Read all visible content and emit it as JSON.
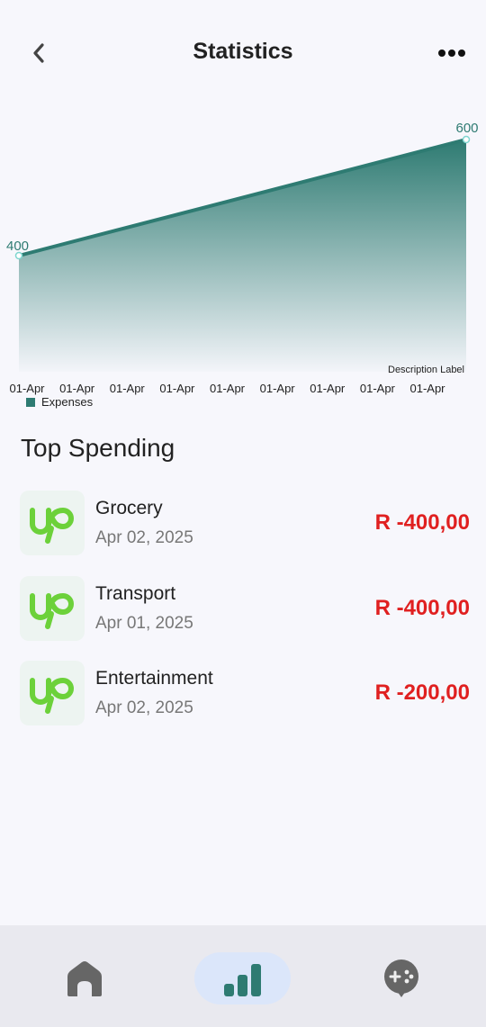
{
  "header": {
    "title": "Statistics"
  },
  "chart_data": {
    "type": "area",
    "x": [
      "01-Apr",
      "01-Apr",
      "01-Apr",
      "01-Apr",
      "01-Apr",
      "01-Apr",
      "01-Apr",
      "01-Apr",
      "01-Apr"
    ],
    "series": [
      {
        "name": "Expenses",
        "points": [
          {
            "label": "400",
            "value": 400
          },
          {
            "label": "600",
            "value": 600
          }
        ]
      }
    ],
    "description_label": "Description Label",
    "colors": {
      "line": "#2e7b72",
      "fill_top": "#2e7b72",
      "marker": "#7fd6d0"
    }
  },
  "section": {
    "title": "Top Spending"
  },
  "transactions": [
    {
      "name": "Grocery",
      "date": "Apr 02, 2025",
      "amount": "R -400,00",
      "logo_text": "Up"
    },
    {
      "name": "Transport",
      "date": "Apr 01, 2025",
      "amount": "R -400,00",
      "logo_text": "Up"
    },
    {
      "name": "Entertainment",
      "date": "Apr 02, 2025",
      "amount": "R -200,00",
      "logo_text": "Up"
    }
  ],
  "nav": {
    "items": [
      "home-icon",
      "bar-chart-icon",
      "game-controller-icon"
    ],
    "active": 1
  }
}
